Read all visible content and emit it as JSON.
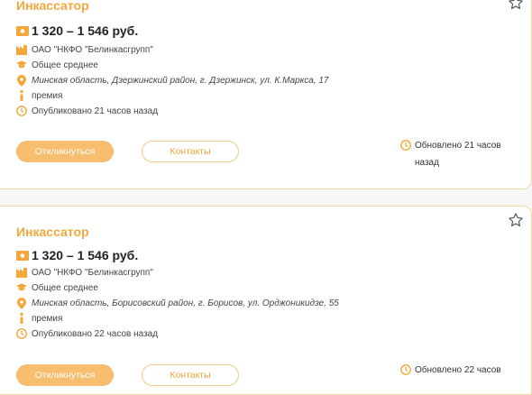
{
  "colors": {
    "accent": "#f2a83a",
    "button_fill": "#f6be6e"
  },
  "cards": [
    {
      "title": "Инкассатор",
      "salary": "1 320 – 1 546 руб.",
      "company": "ОАО \"НКФО \"Белинкасгрупп\"",
      "education": "Общее среднее",
      "location": "Минская область, Дзержинский район, г. Дзержинск, ул. К.Маркса, 17",
      "bonus": "премия",
      "published": "Опубликовано 21 часов назад",
      "respond_label": "Откликнуться",
      "contacts_label": "Контакты",
      "updated": "Обновлено 21 часов назад"
    },
    {
      "title": "Инкассатор",
      "salary": "1 320 – 1 546 руб.",
      "company": "ОАО \"НКФО \"Белинкасгрупп\"",
      "education": "Общее среднее",
      "location": "Минская область, Борисовский район, г. Борисов, ул. Орджоникидзе, 55",
      "bonus": "премия",
      "published": "Опубликовано 22 часов назад",
      "respond_label": "Откликнуться",
      "contacts_label": "Контакты",
      "updated": "Обновлено 22 часов"
    }
  ],
  "icons": [
    "money-icon",
    "building-icon",
    "graduation-cap-icon",
    "location-pin-icon",
    "info-icon",
    "clock-icon",
    "star-icon"
  ]
}
